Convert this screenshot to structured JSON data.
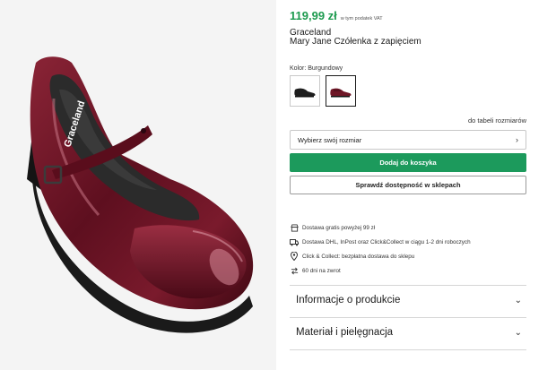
{
  "product": {
    "price": "119,99 zł",
    "vat_note": "w tym podatek VAT",
    "brand": "Graceland",
    "name": "Mary Jane Czółenka z zapięciem",
    "image_alt": "Graceland",
    "insole_brand": "Graceland"
  },
  "color": {
    "label": "Kolor: Burgundowy",
    "swatches": [
      {
        "name": "black-shoe",
        "color": "#1e1e1e"
      },
      {
        "name": "burgundy-shoe",
        "color": "#6e1626"
      }
    ]
  },
  "size": {
    "table_link": "do tabeli rozmiarów",
    "select_label": "Wybierz swój rozmiar"
  },
  "buttons": {
    "add_to_cart": "Dodaj do koszyka",
    "check_availability": "Sprawdź dostępność w sklepach"
  },
  "info": [
    {
      "icon": "shop-icon",
      "text": "Dostawa gratis powyżej 99 zł"
    },
    {
      "icon": "truck-icon",
      "text": "Dostawa DHL, InPost oraz Click&Collect w ciągu 1-2 dni roboczych"
    },
    {
      "icon": "location-pin-icon",
      "text": "Click & Collect: bezpłatna dostawa do sklepu"
    },
    {
      "icon": "return-arrows-icon",
      "text": "60 dni na zwrot"
    }
  ],
  "accordion": [
    {
      "label": "Informacje o produkcie"
    },
    {
      "label": "Materiał i pielęgnacja"
    }
  ],
  "colors": {
    "price_green": "#1c9a4e",
    "button_green": "#1c9a5c",
    "shoe_burgundy": "#6e1626"
  }
}
